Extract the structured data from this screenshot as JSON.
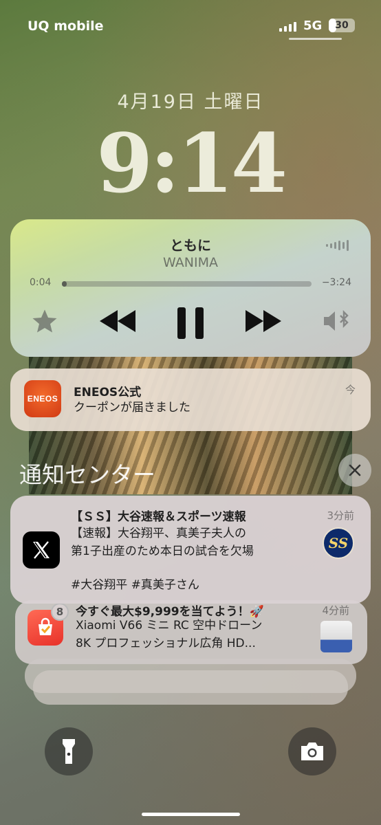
{
  "status_bar": {
    "carrier": "UQ mobile",
    "network": "5G",
    "battery": "30",
    "battery_level": 0.3
  },
  "lock_screen": {
    "date": "4月19日 土曜日",
    "time": "9:14"
  },
  "now_playing": {
    "title": "ともに",
    "artist": "WANIMA",
    "elapsed": "0:04",
    "remaining": "−3:24",
    "progress": 0.02,
    "icons": [
      "star-icon",
      "rewind-icon",
      "pause-icon",
      "fast-forward-icon",
      "speaker-bluetooth-icon",
      "audio-wave-icon"
    ]
  },
  "notifications": {
    "eneos": {
      "app_icon_text": "ENEOS",
      "title": "ENEOS公式",
      "body": "クーポンが届きました",
      "time": "今"
    },
    "header": "通知センター",
    "x_post": {
      "title": "【ＳＳ】大谷速報＆スポーツ速報",
      "body_line1": "【速報】大谷翔平、真美子夫人の",
      "body_line2": "第1子出産のため本日の試合を欠場",
      "tags": "#大谷翔平 #真美子さん",
      "time": "3分前",
      "thumb_text": "SS"
    },
    "shopping": {
      "badge": "8",
      "title": "今すぐ最大$9,999を当てよう！🚀",
      "body_line1": "Xiaomi V66 ミニ RC 空中ドローン",
      "body_line2": "8K プロフェッショナル広角 HD...",
      "time": "4分前"
    }
  },
  "colors": {
    "eneos_red": "#e8442a",
    "x_black": "#000000",
    "shop_red": "#ee3a2e"
  }
}
